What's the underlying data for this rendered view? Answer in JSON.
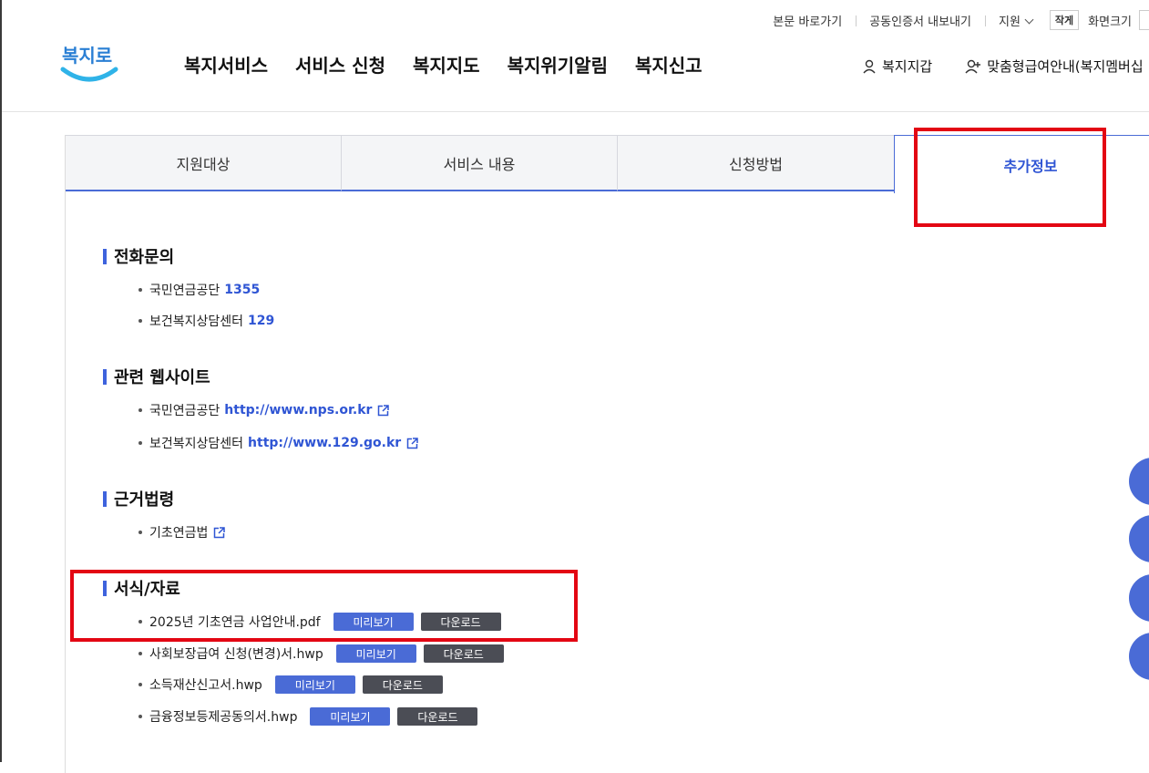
{
  "util": {
    "links": [
      "본문 바로가기",
      "공동인증서 내보내기"
    ],
    "support": "지원",
    "font_small": "작게",
    "font_label": "화면크기"
  },
  "header": {
    "logo_text": "복지로",
    "nav": [
      "복지서비스",
      "서비스 신청",
      "복지지도",
      "복지위기알림",
      "복지신고"
    ],
    "wallet": "복지지갑",
    "custom": "맞춤형급여안내(복지멤버십"
  },
  "tabs": [
    {
      "label": "지원대상",
      "active": false
    },
    {
      "label": "서비스 내용",
      "active": false
    },
    {
      "label": "신청방법",
      "active": false
    },
    {
      "label": "추가정보",
      "active": true
    }
  ],
  "sections": {
    "phone": {
      "title": "전화문의",
      "items": [
        {
          "label": "국민연금공단",
          "value": "1355"
        },
        {
          "label": "보건복지상담센터",
          "value": "129"
        }
      ]
    },
    "websites": {
      "title": "관련 웹사이트",
      "items": [
        {
          "label": "국민연금공단",
          "value": "http://www.nps.or.kr"
        },
        {
          "label": "보건복지상담센터",
          "value": "http://www.129.go.kr"
        }
      ]
    },
    "law": {
      "title": "근거법령",
      "items": [
        {
          "label": "기초연금법"
        }
      ]
    },
    "forms": {
      "title": "서식/자료",
      "preview_label": "미리보기",
      "download_label": "다운로드",
      "items": [
        {
          "file": "2025년 기초연금 사업안내.pdf"
        },
        {
          "file": "사회보장급여 신청(변경)서.hwp"
        },
        {
          "file": "소득재산신고서.hwp"
        },
        {
          "file": "금융정보등제공동의서.hwp"
        }
      ]
    }
  },
  "colors": {
    "accent": "#4a6bd6",
    "highlight": "#e30613",
    "dark_button": "#4b4d55"
  }
}
